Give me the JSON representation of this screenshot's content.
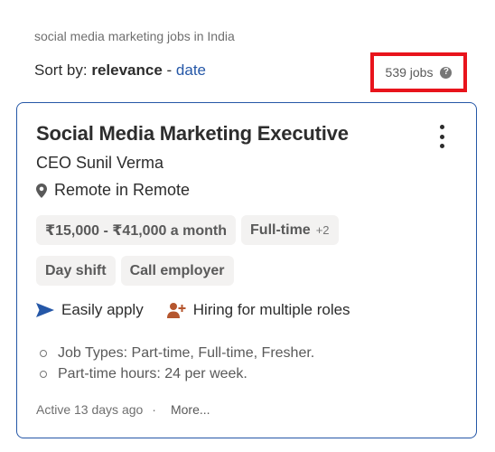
{
  "breadcrumb": "social media marketing jobs in India",
  "sort": {
    "label": "Sort by:",
    "current": "relevance",
    "separator": "-",
    "alternate": "date"
  },
  "job_count": {
    "text": "539 jobs",
    "help_glyph": "?",
    "highlight_color": "#e8141c"
  },
  "job": {
    "title": "Social Media Marketing Executive",
    "company": "CEO Sunil Verma",
    "location": "Remote in Remote",
    "chips": [
      {
        "label": "₹15,000 - ₹41,000 a month",
        "extra": ""
      },
      {
        "label": "Full-time",
        "extra": "+2"
      },
      {
        "label": "Day shift",
        "extra": ""
      },
      {
        "label": "Call employer",
        "extra": ""
      }
    ],
    "features": [
      {
        "icon": "send-arrow-icon",
        "label": "Easily apply"
      },
      {
        "icon": "person-plus-icon",
        "label": "Hiring for multiple roles"
      }
    ],
    "snippet": [
      "Job Types: Part-time, Full-time, Fresher.",
      "Part-time hours: 24 per week."
    ],
    "posted": "Active 13 days ago",
    "footer_separator": "·",
    "more": "More..."
  },
  "colors": {
    "accent_blue": "#2557a7",
    "card_border": "#2557a7",
    "chip_bg": "#f3f2f1",
    "hiring_icon": "#b5562e"
  }
}
